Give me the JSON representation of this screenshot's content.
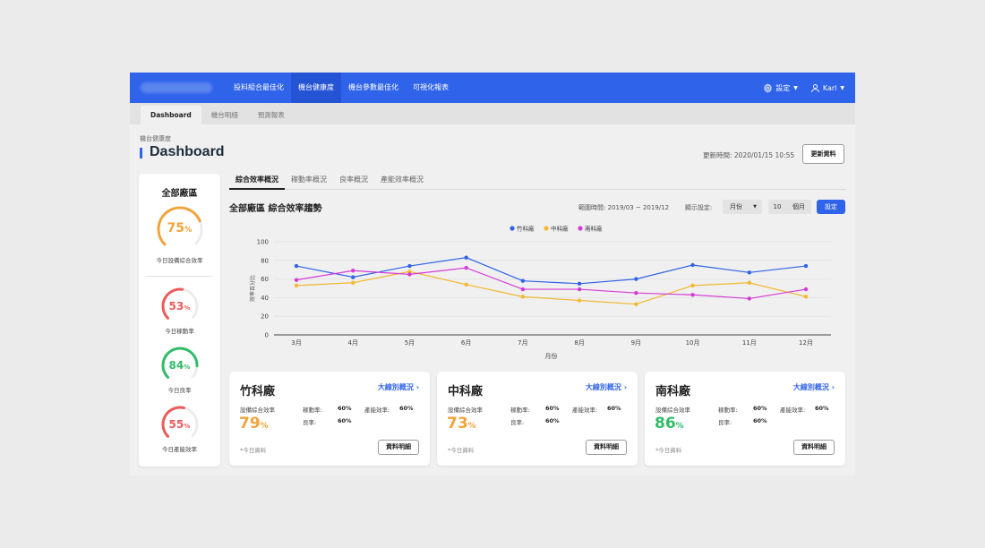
{
  "nav": {
    "items": [
      "投料組合最佳化",
      "機台健康度",
      "機台參數最佳化",
      "可視化報表"
    ],
    "active_index": 1,
    "settings_label": "設定",
    "user_name": "Karl"
  },
  "subtabs": [
    "Dashboard",
    "機台明細",
    "預測報表"
  ],
  "header": {
    "breadcrumb": "機台健康度",
    "title": "Dashboard",
    "updated": "更新時間: 2020/01/15 10:55",
    "refresh_label": "更新資料"
  },
  "left_panel": {
    "title": "全部廠區",
    "gauges": [
      {
        "value": "75",
        "unit": "%",
        "label": "今日設備綜合效率",
        "color": "#f2a33a",
        "percent": 75
      },
      {
        "value": "53",
        "unit": "%",
        "label": "今日稼動率",
        "color": "#ee5a5a",
        "percent": 53
      },
      {
        "value": "84",
        "unit": "%",
        "label": "今日良率",
        "color": "#2fbd67",
        "percent": 84
      },
      {
        "value": "55",
        "unit": "%",
        "label": "今日產能效率",
        "color": "#ee5a5a",
        "percent": 55
      }
    ]
  },
  "main_tabs": [
    "綜合效率概況",
    "稼動率概況",
    "良率概況",
    "產能效率概況"
  ],
  "section": {
    "title": "全部廠區 綜合效率趨勢",
    "range": "範圍時間: 2019/03 ~ 2019/12",
    "display_label": "顯示設定:",
    "select_value": "月份",
    "count_value": "10",
    "count_unit": "個月",
    "set_label": "設定"
  },
  "chart_data": {
    "type": "line",
    "categories": [
      "3月",
      "4月",
      "5月",
      "6月",
      "7月",
      "8月",
      "9月",
      "10月",
      "11月",
      "12月"
    ],
    "series": [
      {
        "name": "竹科廠",
        "color": "#2f63ea",
        "values": [
          74,
          62,
          74,
          83,
          58,
          55,
          60,
          75,
          67,
          74
        ]
      },
      {
        "name": "中科廠",
        "color": "#f2b830",
        "values": [
          53,
          56,
          68,
          54,
          41,
          37,
          33,
          53,
          56,
          41
        ]
      },
      {
        "name": "南科廠",
        "color": "#d63ad6",
        "values": [
          59,
          69,
          65,
          72,
          49,
          49,
          45,
          43,
          39,
          49
        ]
      }
    ],
    "yticks": [
      0,
      20,
      40,
      60,
      80,
      100
    ],
    "ylim": [
      0,
      100
    ],
    "xlabel": "月份",
    "ylabel": "效率百分比",
    "legend": "top-center",
    "grid": true
  },
  "cards": [
    {
      "name": "竹科廠",
      "link": "大線別概況",
      "oee_label": "設備綜合效率",
      "oee_value": "79",
      "oee_unit": "%",
      "oee_color": "#f2a33a",
      "util_label": "稼動率:",
      "util_value": "60%",
      "yield_label": "良率:",
      "yield_value": "60%",
      "cap_label": "產能效率:",
      "cap_value": "60%",
      "note": "*今日資料",
      "button": "資料明細"
    },
    {
      "name": "中科廠",
      "link": "大線別概況",
      "oee_label": "設備綜合效率",
      "oee_value": "73",
      "oee_unit": "%",
      "oee_color": "#f2a33a",
      "util_label": "稼動率:",
      "util_value": "60%",
      "yield_label": "良率:",
      "yield_value": "60%",
      "cap_label": "產能效率:",
      "cap_value": "60%",
      "note": "*今日資料",
      "button": "資料明細"
    },
    {
      "name": "南科廠",
      "link": "大線別概況",
      "oee_label": "設備綜合效率",
      "oee_value": "86",
      "oee_unit": "%",
      "oee_color": "#2fbd67",
      "util_label": "稼動率:",
      "util_value": "60%",
      "yield_label": "良率:",
      "yield_value": "60%",
      "cap_label": "產能效率:",
      "cap_value": "60%",
      "note": "*今日資料",
      "button": "資料明細"
    }
  ]
}
